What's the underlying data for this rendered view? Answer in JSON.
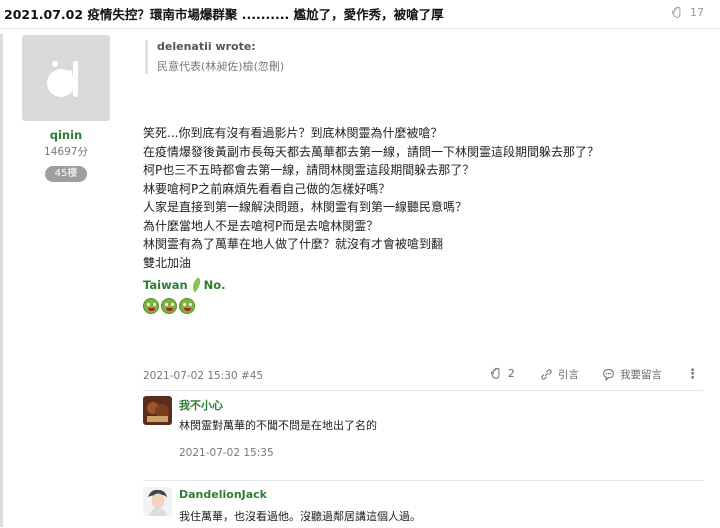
{
  "thread": {
    "title": "2021.07.02 疫情失控？環南市場爆群聚 .......... 尷尬了，愛作秀，被嗆了厚",
    "like_count": "17"
  },
  "post": {
    "quote": {
      "author": "delenatii wrote:",
      "text": "民意代表(林昶佐)檢(忽刪)"
    },
    "author": {
      "name": "qinin",
      "points": "14697分",
      "floor": "45樓"
    },
    "body_lines": [
      "笑死...你到底有沒有看過影片？到底林閔靈為什麼被嗆？",
      "在疫情爆發後黃副市長每天都去萬華都去第一線，請問一下林閔霊這段期間躲去那了？",
      "柯P也三不五時都會去第一線，請問林閔霊這段期間躲去那了？",
      "林要嗆柯P之前麻煩先看看自己做的怎樣好嗎？",
      "人家是直接到第一線解決問題，林閔霊有到第一線聽民意嗎？",
      "為什麼當地人不是去嗆柯P而是去嗆林閔霊？",
      "林閔霊有為了萬華在地人做了什麼？就沒有才會被嗆到翻",
      "雙北加油"
    ],
    "signature": {
      "left": "Taiwan",
      "right": "No."
    },
    "emoji_names": [
      "grin-emoji",
      "grin-emoji",
      "grin-emoji"
    ],
    "meta": "2021-07-02 15:30 #45",
    "actions": {
      "like_count": "2",
      "quote_label": "引言",
      "comment_label": "我要留言",
      "more_label": "⋮"
    }
  },
  "replies": [
    {
      "name": "我不小心",
      "text": "林閔霊對萬華的不聞不問是在地出了名的",
      "time": "2021-07-02 15:35"
    },
    {
      "name": "DandelionJack",
      "text": "我住萬華，也沒看過他。沒聽過鄰居講這個人過。",
      "time": ""
    }
  ],
  "colors": {
    "accent_green": "#2e7d32",
    "floor_badge": "#9e9e9e"
  }
}
